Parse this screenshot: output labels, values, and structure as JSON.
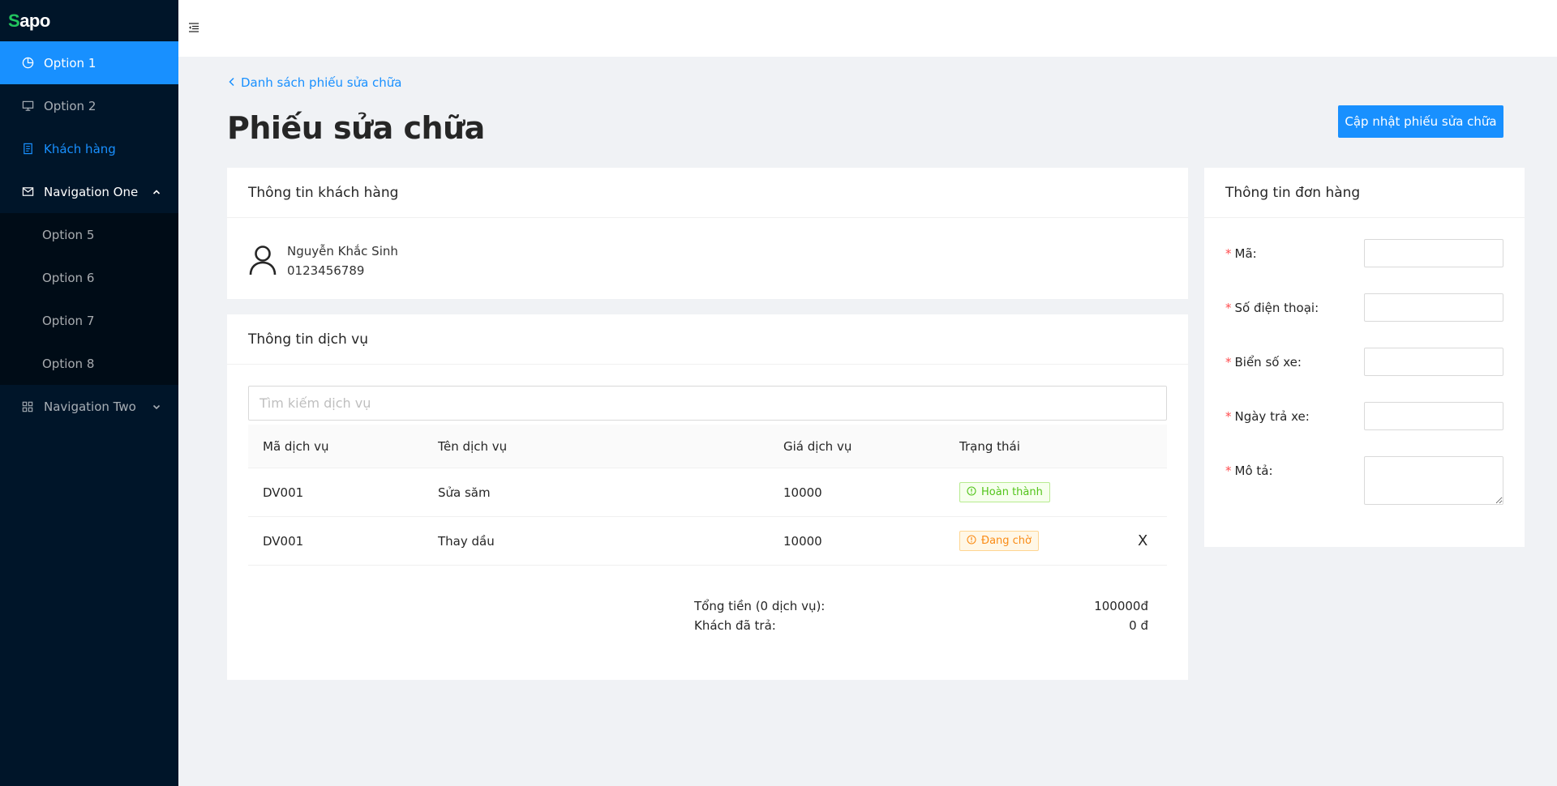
{
  "sidebar": {
    "logo": "Sapo",
    "items": [
      {
        "label": "Option 1",
        "icon": "pie-chart-icon"
      },
      {
        "label": "Option 2",
        "icon": "desktop-icon"
      },
      {
        "label": "Khách hàng",
        "icon": "file-icon"
      },
      {
        "label": "Navigation One",
        "icon": "mail-icon"
      },
      {
        "label": "Option 5"
      },
      {
        "label": "Option 6"
      },
      {
        "label": "Option 7"
      },
      {
        "label": "Option 8"
      },
      {
        "label": "Navigation Two",
        "icon": "appstore-icon"
      }
    ]
  },
  "breadcrumb": {
    "back_label": "Danh sách phiếu sửa chữa"
  },
  "page": {
    "title": "Phiếu sửa chữa",
    "update_button": "Cập nhật phiếu sửa chữa"
  },
  "customer": {
    "card_title": "Thông tin khách hàng",
    "name": "Nguyễn Khắc Sinh",
    "phone": "0123456789"
  },
  "services": {
    "card_title": "Thông tin dịch vụ",
    "search_placeholder": "Tìm kiếm dịch vụ",
    "columns": [
      "Mã dịch vụ",
      "Tên dịch vụ",
      "Giá dịch vụ",
      "Trạng thái"
    ],
    "rows": [
      {
        "code": "DV001",
        "name": "Sửa săm",
        "price": "10000",
        "status": "Hoàn thành",
        "status_type": "success"
      },
      {
        "code": "DV001",
        "name": "Thay dầu",
        "price": "10000",
        "status": "Đang chờ",
        "status_type": "warning",
        "remove": "X"
      }
    ],
    "total_label": "Tổng tiền (0 dịch vụ):",
    "total_value": "100000đ",
    "paid_label": "Khách đã trả:",
    "paid_value": "0 đ"
  },
  "order": {
    "card_title": "Thông tin đơn hàng",
    "fields": [
      {
        "label": "Mã:",
        "value": ""
      },
      {
        "label": "Số điện thoại:",
        "value": ""
      },
      {
        "label": "Biển số xe:",
        "value": ""
      },
      {
        "label": "Ngày trả xe:",
        "value": ""
      },
      {
        "label": "Mô tả:",
        "value": ""
      }
    ]
  },
  "colors": {
    "primary": "#1890ff",
    "sidebar": "#001529",
    "success": "#52c41a",
    "warning": "#fa8c16"
  }
}
